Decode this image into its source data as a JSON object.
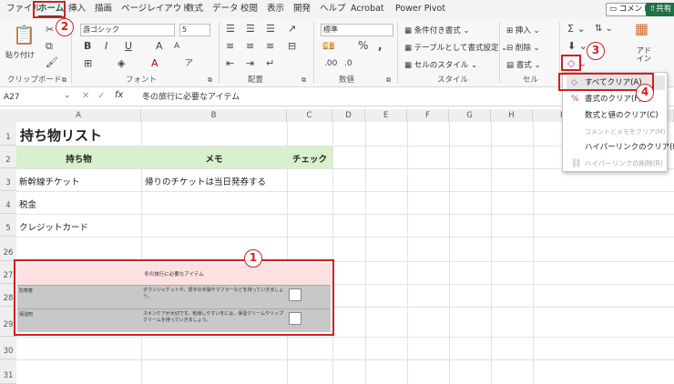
{
  "menu": {
    "tabs": [
      "ファイル",
      "ホーム",
      "挿入",
      "描画",
      "ページレイアウト",
      "数式",
      "データ",
      "校閲",
      "表示",
      "開発",
      "ヘルプ",
      "Acrobat",
      "Power Pivot"
    ],
    "comment_label": "コメント",
    "share_label": "共有"
  },
  "ribbon": {
    "clipboard": {
      "paste_label": "貼り付け",
      "group_label": "クリップボード"
    },
    "font": {
      "font_name": "游ゴシック",
      "font_size": "5",
      "group_label": "フォント"
    },
    "alignment": {
      "group_label": "配置"
    },
    "number": {
      "format": "標準",
      "group_label": "数値"
    },
    "styles": {
      "conditional": "条件付き書式",
      "table": "テーブルとして書式設定",
      "cell_style": "セルのスタイル",
      "group_label": "スタイル"
    },
    "cells": {
      "insert": "挿入",
      "delete": "削除",
      "format": "書式",
      "group_label": "セル"
    },
    "addin_label": "アドイン"
  },
  "formula_bar": {
    "name_box": "A27",
    "formula": "冬の旅行に必要なアイテム"
  },
  "grid": {
    "columns": [
      "A",
      "B",
      "C",
      "D",
      "E",
      "F",
      "G",
      "H",
      "I"
    ],
    "rows": [
      "1",
      "2",
      "3",
      "4",
      "5",
      "26",
      "27",
      "28",
      "29",
      "30",
      "31"
    ],
    "title": "持ち物リスト",
    "headers": {
      "item": "持ち物",
      "memo": "メモ",
      "check": "チェック"
    },
    "items": [
      {
        "name": "新幹線チケット",
        "memo": "帰りのチケットは当日発券する"
      },
      {
        "name": "税金",
        "memo": ""
      },
      {
        "name": "クレジットカード",
        "memo": ""
      }
    ],
    "textbox": {
      "title": "冬の旅行に必要なアイテム",
      "rows": [
        {
          "label": "防寒着",
          "text": "ダウンジャケットや、厚手の手袋やマフラーなどを持っていきましょう。"
        },
        {
          "label": "保湿剤",
          "text": "スキンケアが大切です。乾燥しやすい冬には、保湿クリームやリップクリームを持っていきましょう。"
        }
      ]
    }
  },
  "clear_menu": {
    "items": [
      {
        "label": "すべてクリア(A)",
        "enabled": true,
        "highlighted": true
      },
      {
        "label": "書式のクリア(F)",
        "enabled": true
      },
      {
        "label": "数式と値のクリア(C)",
        "enabled": true
      },
      {
        "label": "コメントとメモをクリア(M)",
        "enabled": false
      },
      {
        "label": "ハイパーリンクのクリア(L)",
        "enabled": true
      },
      {
        "label": "ハイパーリンクの削除(R)",
        "enabled": false
      }
    ]
  },
  "callouts": [
    "1",
    "2",
    "3",
    "4"
  ],
  "colors": {
    "accent": "#185c37",
    "callout": "#d11f1f",
    "header_fill": "#d9f0cc",
    "textbox_title_fill": "#fde0e0",
    "textbox_row_fill": "#c8c8c8"
  }
}
